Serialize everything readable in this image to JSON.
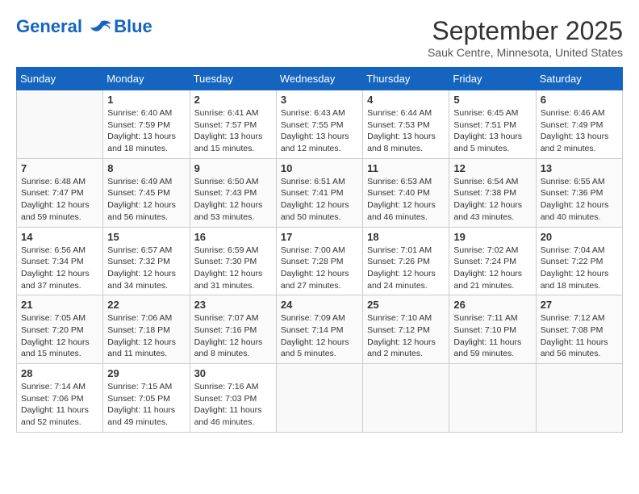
{
  "header": {
    "logo_line1": "General",
    "logo_line2": "Blue",
    "month": "September 2025",
    "location": "Sauk Centre, Minnesota, United States"
  },
  "columns": [
    "Sunday",
    "Monday",
    "Tuesday",
    "Wednesday",
    "Thursday",
    "Friday",
    "Saturday"
  ],
  "weeks": [
    [
      {
        "day": "",
        "sunrise": "",
        "sunset": "",
        "daylight": ""
      },
      {
        "day": "1",
        "sunrise": "Sunrise: 6:40 AM",
        "sunset": "Sunset: 7:59 PM",
        "daylight": "Daylight: 13 hours and 18 minutes."
      },
      {
        "day": "2",
        "sunrise": "Sunrise: 6:41 AM",
        "sunset": "Sunset: 7:57 PM",
        "daylight": "Daylight: 13 hours and 15 minutes."
      },
      {
        "day": "3",
        "sunrise": "Sunrise: 6:43 AM",
        "sunset": "Sunset: 7:55 PM",
        "daylight": "Daylight: 13 hours and 12 minutes."
      },
      {
        "day": "4",
        "sunrise": "Sunrise: 6:44 AM",
        "sunset": "Sunset: 7:53 PM",
        "daylight": "Daylight: 13 hours and 8 minutes."
      },
      {
        "day": "5",
        "sunrise": "Sunrise: 6:45 AM",
        "sunset": "Sunset: 7:51 PM",
        "daylight": "Daylight: 13 hours and 5 minutes."
      },
      {
        "day": "6",
        "sunrise": "Sunrise: 6:46 AM",
        "sunset": "Sunset: 7:49 PM",
        "daylight": "Daylight: 13 hours and 2 minutes."
      }
    ],
    [
      {
        "day": "7",
        "sunrise": "Sunrise: 6:48 AM",
        "sunset": "Sunset: 7:47 PM",
        "daylight": "Daylight: 12 hours and 59 minutes."
      },
      {
        "day": "8",
        "sunrise": "Sunrise: 6:49 AM",
        "sunset": "Sunset: 7:45 PM",
        "daylight": "Daylight: 12 hours and 56 minutes."
      },
      {
        "day": "9",
        "sunrise": "Sunrise: 6:50 AM",
        "sunset": "Sunset: 7:43 PM",
        "daylight": "Daylight: 12 hours and 53 minutes."
      },
      {
        "day": "10",
        "sunrise": "Sunrise: 6:51 AM",
        "sunset": "Sunset: 7:41 PM",
        "daylight": "Daylight: 12 hours and 50 minutes."
      },
      {
        "day": "11",
        "sunrise": "Sunrise: 6:53 AM",
        "sunset": "Sunset: 7:40 PM",
        "daylight": "Daylight: 12 hours and 46 minutes."
      },
      {
        "day": "12",
        "sunrise": "Sunrise: 6:54 AM",
        "sunset": "Sunset: 7:38 PM",
        "daylight": "Daylight: 12 hours and 43 minutes."
      },
      {
        "day": "13",
        "sunrise": "Sunrise: 6:55 AM",
        "sunset": "Sunset: 7:36 PM",
        "daylight": "Daylight: 12 hours and 40 minutes."
      }
    ],
    [
      {
        "day": "14",
        "sunrise": "Sunrise: 6:56 AM",
        "sunset": "Sunset: 7:34 PM",
        "daylight": "Daylight: 12 hours and 37 minutes."
      },
      {
        "day": "15",
        "sunrise": "Sunrise: 6:57 AM",
        "sunset": "Sunset: 7:32 PM",
        "daylight": "Daylight: 12 hours and 34 minutes."
      },
      {
        "day": "16",
        "sunrise": "Sunrise: 6:59 AM",
        "sunset": "Sunset: 7:30 PM",
        "daylight": "Daylight: 12 hours and 31 minutes."
      },
      {
        "day": "17",
        "sunrise": "Sunrise: 7:00 AM",
        "sunset": "Sunset: 7:28 PM",
        "daylight": "Daylight: 12 hours and 27 minutes."
      },
      {
        "day": "18",
        "sunrise": "Sunrise: 7:01 AM",
        "sunset": "Sunset: 7:26 PM",
        "daylight": "Daylight: 12 hours and 24 minutes."
      },
      {
        "day": "19",
        "sunrise": "Sunrise: 7:02 AM",
        "sunset": "Sunset: 7:24 PM",
        "daylight": "Daylight: 12 hours and 21 minutes."
      },
      {
        "day": "20",
        "sunrise": "Sunrise: 7:04 AM",
        "sunset": "Sunset: 7:22 PM",
        "daylight": "Daylight: 12 hours and 18 minutes."
      }
    ],
    [
      {
        "day": "21",
        "sunrise": "Sunrise: 7:05 AM",
        "sunset": "Sunset: 7:20 PM",
        "daylight": "Daylight: 12 hours and 15 minutes."
      },
      {
        "day": "22",
        "sunrise": "Sunrise: 7:06 AM",
        "sunset": "Sunset: 7:18 PM",
        "daylight": "Daylight: 12 hours and 11 minutes."
      },
      {
        "day": "23",
        "sunrise": "Sunrise: 7:07 AM",
        "sunset": "Sunset: 7:16 PM",
        "daylight": "Daylight: 12 hours and 8 minutes."
      },
      {
        "day": "24",
        "sunrise": "Sunrise: 7:09 AM",
        "sunset": "Sunset: 7:14 PM",
        "daylight": "Daylight: 12 hours and 5 minutes."
      },
      {
        "day": "25",
        "sunrise": "Sunrise: 7:10 AM",
        "sunset": "Sunset: 7:12 PM",
        "daylight": "Daylight: 12 hours and 2 minutes."
      },
      {
        "day": "26",
        "sunrise": "Sunrise: 7:11 AM",
        "sunset": "Sunset: 7:10 PM",
        "daylight": "Daylight: 11 hours and 59 minutes."
      },
      {
        "day": "27",
        "sunrise": "Sunrise: 7:12 AM",
        "sunset": "Sunset: 7:08 PM",
        "daylight": "Daylight: 11 hours and 56 minutes."
      }
    ],
    [
      {
        "day": "28",
        "sunrise": "Sunrise: 7:14 AM",
        "sunset": "Sunset: 7:06 PM",
        "daylight": "Daylight: 11 hours and 52 minutes."
      },
      {
        "day": "29",
        "sunrise": "Sunrise: 7:15 AM",
        "sunset": "Sunset: 7:05 PM",
        "daylight": "Daylight: 11 hours and 49 minutes."
      },
      {
        "day": "30",
        "sunrise": "Sunrise: 7:16 AM",
        "sunset": "Sunset: 7:03 PM",
        "daylight": "Daylight: 11 hours and 46 minutes."
      },
      {
        "day": "",
        "sunrise": "",
        "sunset": "",
        "daylight": ""
      },
      {
        "day": "",
        "sunrise": "",
        "sunset": "",
        "daylight": ""
      },
      {
        "day": "",
        "sunrise": "",
        "sunset": "",
        "daylight": ""
      },
      {
        "day": "",
        "sunrise": "",
        "sunset": "",
        "daylight": ""
      }
    ]
  ]
}
